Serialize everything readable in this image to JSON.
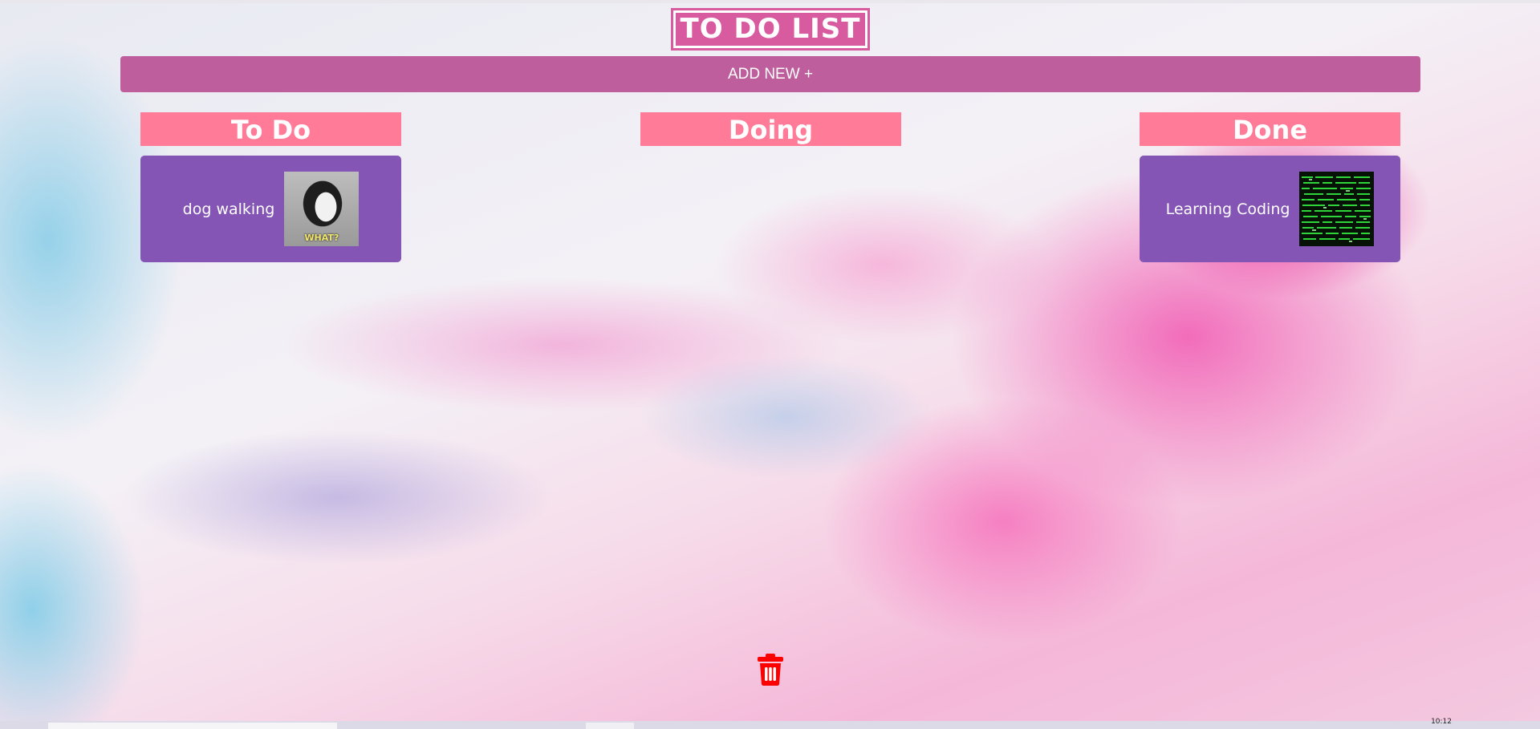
{
  "app": {
    "title": "TO DO LIST",
    "add_new_label": "ADD NEW +"
  },
  "columns": [
    {
      "title": "To Do",
      "cards": [
        {
          "text": "dog walking",
          "image_caption": "WHAT?",
          "image": "dog-photo"
        }
      ]
    },
    {
      "title": "Doing",
      "cards": []
    },
    {
      "title": "Done",
      "cards": [
        {
          "text": "Learning Coding",
          "image": "green-code-matrix"
        }
      ]
    }
  ],
  "icons": {
    "delete": "trash-icon"
  },
  "taskbar": {
    "clock": "10:12"
  },
  "colors": {
    "title_pink": "#d85a9f",
    "add_new_bar": "#bf5e9c",
    "column_header": "#ff7b98",
    "card_purple": "#8455b4",
    "trash_red": "#ff0000"
  }
}
